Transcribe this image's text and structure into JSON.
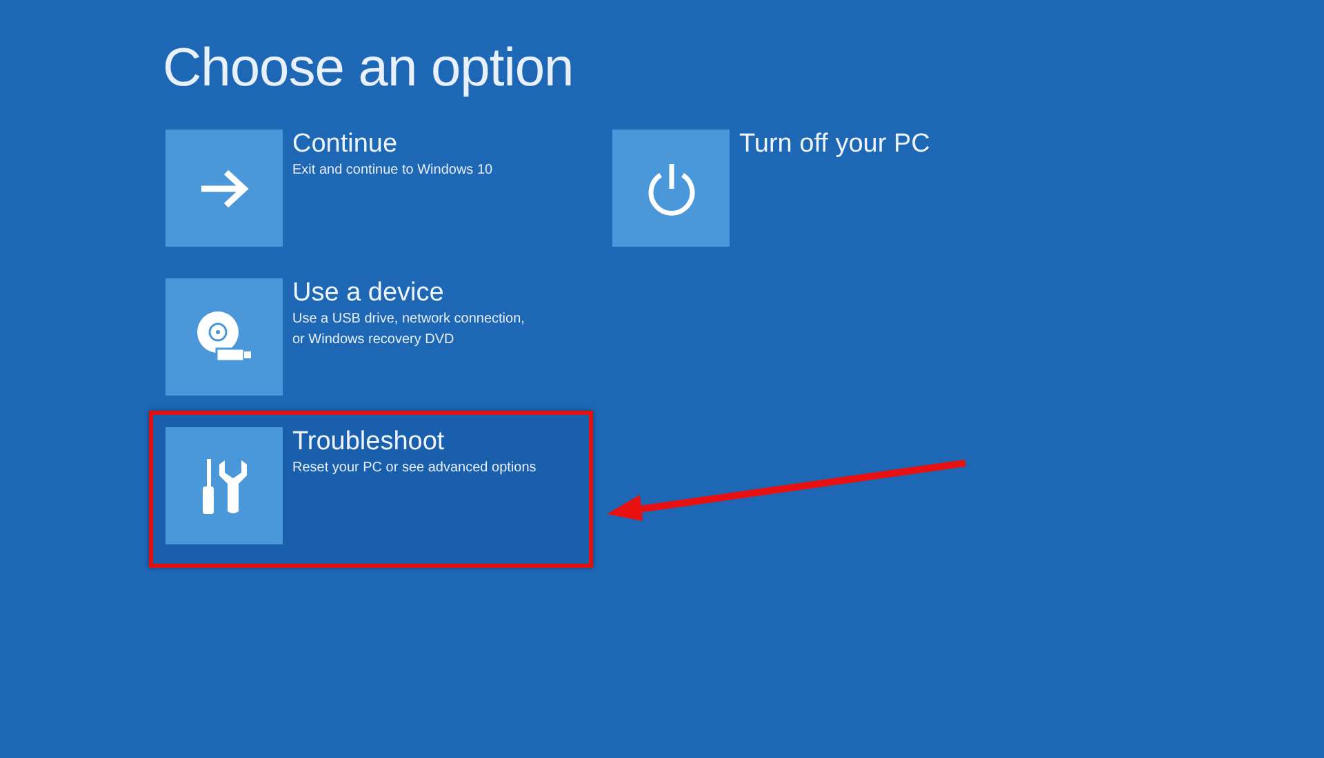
{
  "title": "Choose an option",
  "columns": [
    {
      "options": [
        {
          "kind": "continue",
          "title": "Continue",
          "description": [
            "Exit and continue to Windows 10"
          ],
          "highlighted": false
        },
        {
          "kind": "device",
          "title": "Use a device",
          "description": [
            "Use a USB drive, network connection,",
            "or Windows recovery DVD"
          ],
          "highlighted": false
        },
        {
          "kind": "troubleshoot",
          "title": "Troubleshoot",
          "description": [
            "Reset your PC or see advanced options"
          ],
          "highlighted": true
        }
      ]
    },
    {
      "options": [
        {
          "kind": "power",
          "title": "Turn off your PC",
          "highlighted": false
        }
      ]
    }
  ]
}
